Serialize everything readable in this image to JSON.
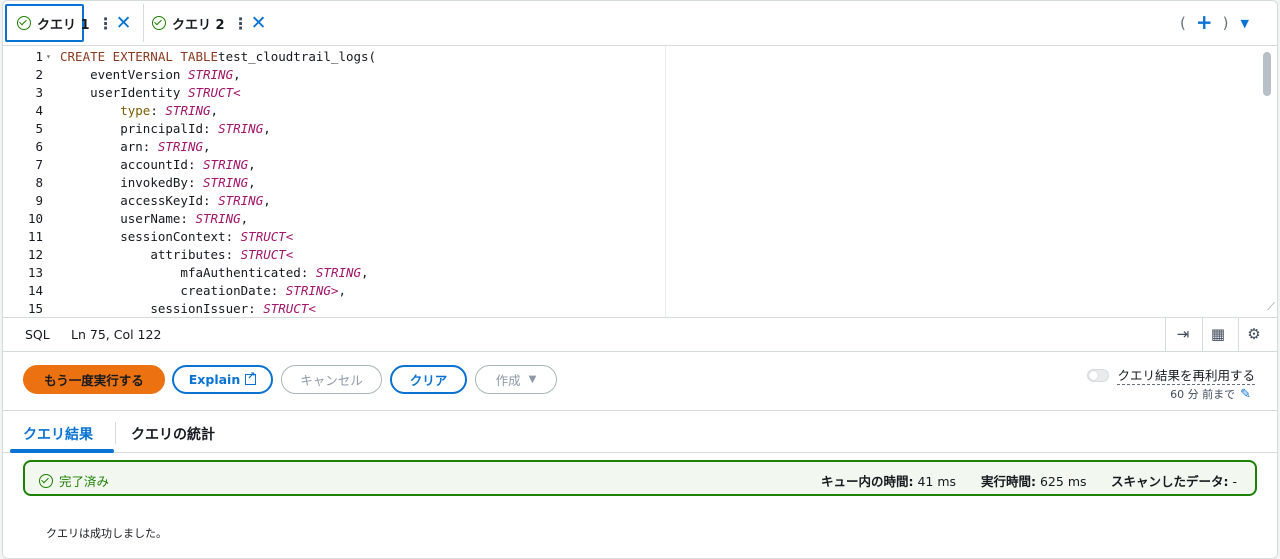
{
  "tabs": [
    {
      "label": "クエリ 1",
      "active": true
    },
    {
      "label": "クエリ 2",
      "active": false
    }
  ],
  "tab_controls": {
    "open_paren": "(",
    "close_paren": ")"
  },
  "editor": {
    "language": "SQL",
    "cursor": "Ln 75, Col 122",
    "lines": [
      {
        "n": "1",
        "indent": "",
        "parts": [
          [
            "kw",
            "CREATE EXTERNAL TABLE"
          ],
          [
            "",
            "test_cloudtrail_logs("
          ]
        ]
      },
      {
        "n": "2",
        "indent": "    ",
        "parts": [
          [
            "",
            "eventVersion "
          ],
          [
            "ty",
            "STRING"
          ],
          [
            "",
            ","
          ]
        ]
      },
      {
        "n": "3",
        "indent": "    ",
        "parts": [
          [
            "",
            "userIdentity "
          ],
          [
            "ty",
            "STRUCT<"
          ]
        ]
      },
      {
        "n": "4",
        "indent": "        ",
        "parts": [
          [
            "attr",
            "type"
          ],
          [
            "",
            ": "
          ],
          [
            "ty",
            "STRING"
          ],
          [
            "",
            ","
          ]
        ]
      },
      {
        "n": "5",
        "indent": "        ",
        "parts": [
          [
            "",
            "principalId: "
          ],
          [
            "ty",
            "STRING"
          ],
          [
            "",
            ","
          ]
        ]
      },
      {
        "n": "6",
        "indent": "        ",
        "parts": [
          [
            "",
            "arn: "
          ],
          [
            "ty",
            "STRING"
          ],
          [
            "",
            ","
          ]
        ]
      },
      {
        "n": "7",
        "indent": "        ",
        "parts": [
          [
            "",
            "accountId: "
          ],
          [
            "ty",
            "STRING"
          ],
          [
            "",
            ","
          ]
        ]
      },
      {
        "n": "8",
        "indent": "        ",
        "parts": [
          [
            "",
            "invokedBy: "
          ],
          [
            "ty",
            "STRING"
          ],
          [
            "",
            ","
          ]
        ]
      },
      {
        "n": "9",
        "indent": "        ",
        "parts": [
          [
            "",
            "accessKeyId: "
          ],
          [
            "ty",
            "STRING"
          ],
          [
            "",
            ","
          ]
        ]
      },
      {
        "n": "10",
        "indent": "        ",
        "parts": [
          [
            "",
            "userName: "
          ],
          [
            "ty",
            "STRING"
          ],
          [
            "",
            ","
          ]
        ]
      },
      {
        "n": "11",
        "indent": "        ",
        "parts": [
          [
            "",
            "sessionContext: "
          ],
          [
            "ty",
            "STRUCT<"
          ]
        ]
      },
      {
        "n": "12",
        "indent": "            ",
        "parts": [
          [
            "",
            "attributes: "
          ],
          [
            "ty",
            "STRUCT<"
          ]
        ]
      },
      {
        "n": "13",
        "indent": "                ",
        "parts": [
          [
            "",
            "mfaAuthenticated: "
          ],
          [
            "ty",
            "STRING"
          ],
          [
            "",
            ","
          ]
        ]
      },
      {
        "n": "14",
        "indent": "                ",
        "parts": [
          [
            "",
            "creationDate: "
          ],
          [
            "ty",
            "STRING>"
          ],
          [
            "",
            ","
          ]
        ]
      },
      {
        "n": "15",
        "indent": "            ",
        "parts": [
          [
            "",
            "sessionIssuer: "
          ],
          [
            "ty",
            "STRUCT<"
          ]
        ]
      }
    ]
  },
  "actions": {
    "run_again": "もう一度実行する",
    "explain": "Explain",
    "cancel": "キャンセル",
    "clear": "クリア",
    "create": "作成",
    "reuse_label": "クエリ結果を再利用する",
    "reuse_sub": "60 分 前まで"
  },
  "result_tabs": {
    "results": "クエリ結果",
    "stats": "クエリの統計"
  },
  "status": {
    "state": "完了済み",
    "queue_label": "キュー内の時間:",
    "queue_value": "41 ms",
    "run_label": "実行時間:",
    "run_value": "625 ms",
    "scan_label": "スキャンしたデータ:",
    "scan_value": "-"
  },
  "message": "クエリは成功しました。",
  "colors": {
    "accent": "#0972d3",
    "primary_button": "#ec7211",
    "success": "#1d8102"
  }
}
